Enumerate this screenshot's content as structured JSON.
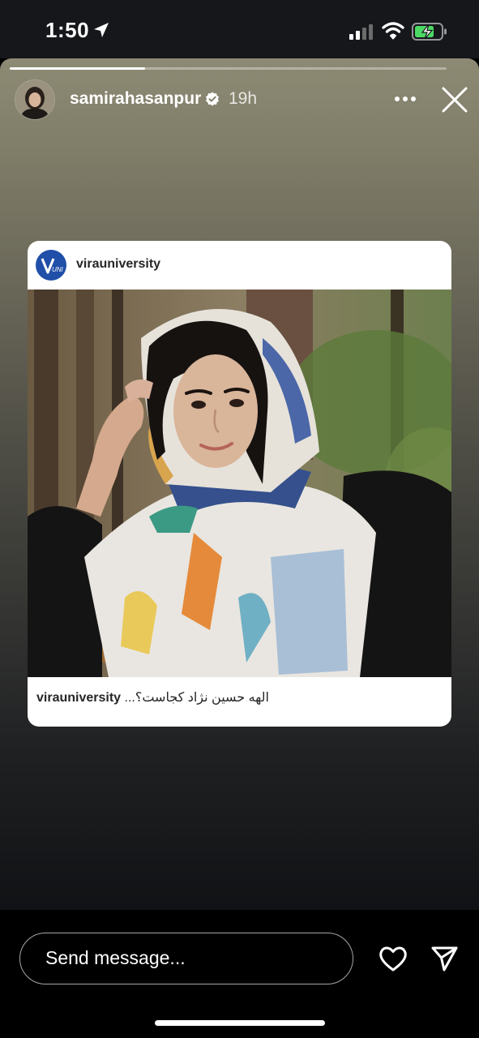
{
  "status_bar": {
    "time": "1:50",
    "icons": [
      "location-arrow-icon",
      "cellular-signal-icon",
      "wifi-icon",
      "battery-charging-icon"
    ]
  },
  "story": {
    "progress": 0.31,
    "username": "samirahasanpur",
    "verified": true,
    "age": "19h",
    "colors": {
      "bg_top": "#8d8a74",
      "bg_bottom": "#111215"
    }
  },
  "shared_post": {
    "account": "virauniversity",
    "caption_user": "virauniversity",
    "caption_text": "الهه حسین نژاد کجاست؟...",
    "logo_color": "#1f4fa8"
  },
  "footer": {
    "message_placeholder": "Send message..."
  }
}
